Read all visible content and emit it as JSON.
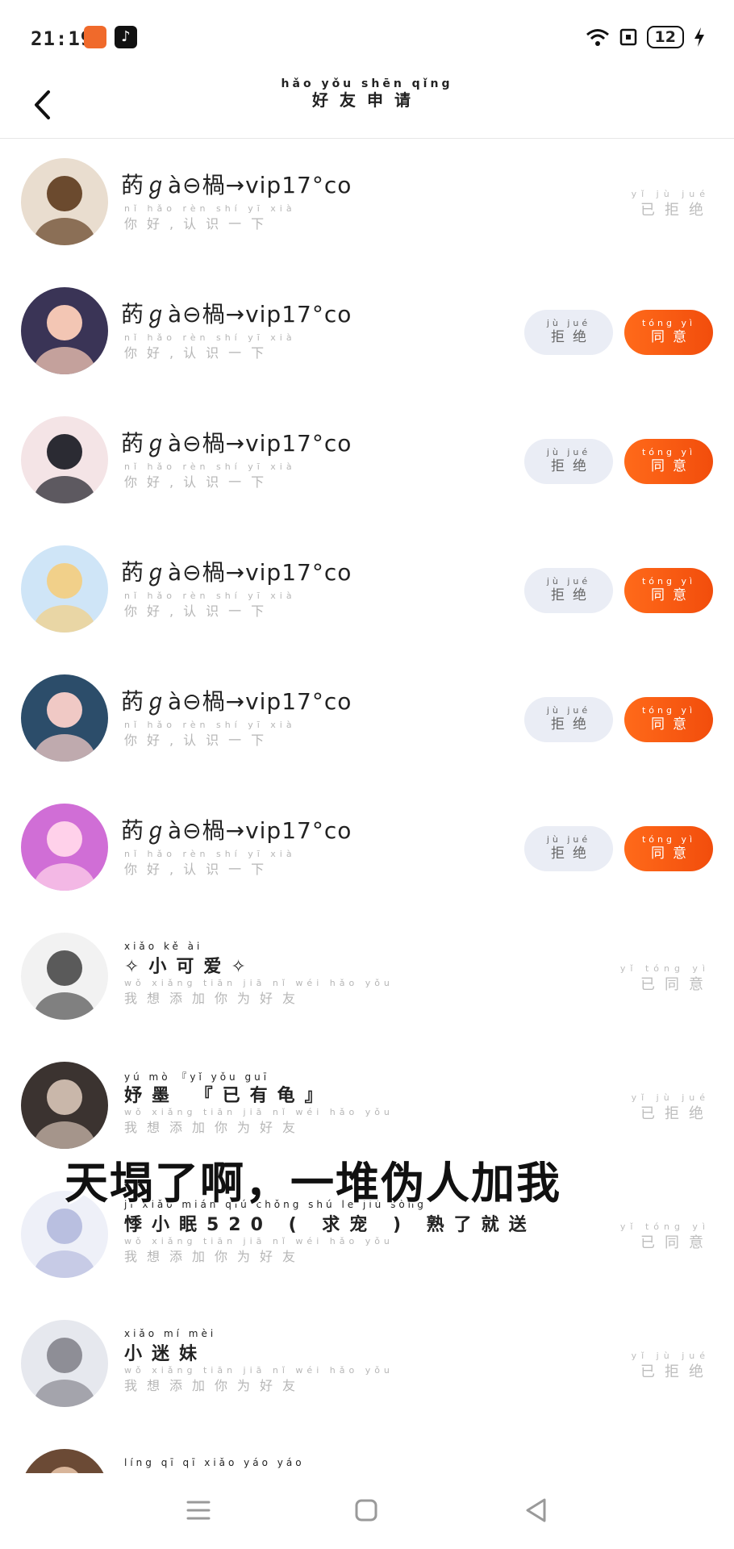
{
  "status_bar": {
    "time": "21:19",
    "battery": "12",
    "tiktok_glyph": "♪"
  },
  "header": {
    "title_pinyin": "hǎo yǒu shēn qǐng",
    "title": "好友申请"
  },
  "requests": [
    {
      "avatar": {
        "bg": "#e9ddcf",
        "fg": "#6b4a2e"
      },
      "name": "菂ℊà⊖楇→vip17°co",
      "msg_pinyin": "nǐ hǎo rèn shí yī xià",
      "msg": "你好,认识一下",
      "status_pinyin": "yǐ jù jué",
      "status": "已拒绝",
      "actions": false
    },
    {
      "avatar": {
        "bg": "#3a3456",
        "fg": "#f3c6b4"
      },
      "name": "菂ℊà⊖楇→vip17°co",
      "msg_pinyin": "nǐ hǎo rèn shí yī xià",
      "msg": "你好,认识一下",
      "actions": true
    },
    {
      "avatar": {
        "bg": "#f4e4e6",
        "fg": "#2b2b33"
      },
      "name": "菂ℊà⊖楇→vip17°co",
      "msg_pinyin": "nǐ hǎo rèn shí yī xià",
      "msg": "你好,认识一下",
      "actions": true
    },
    {
      "avatar": {
        "bg": "#cfe5f7",
        "fg": "#f1d08a"
      },
      "name": "菂ℊà⊖楇→vip17°co",
      "msg_pinyin": "nǐ hǎo rèn shí yī xià",
      "msg": "你好,认识一下",
      "actions": true
    },
    {
      "avatar": {
        "bg": "#2c4d6a",
        "fg": "#f0c9c5"
      },
      "name": "菂ℊà⊖楇→vip17°co",
      "msg_pinyin": "nǐ hǎo rèn shí yī xià",
      "msg": "你好,认识一下",
      "actions": true
    },
    {
      "avatar": {
        "bg": "#d06ed6",
        "fg": "#ffd1ea"
      },
      "name": "菂ℊà⊖楇→vip17°co",
      "msg_pinyin": "nǐ hǎo rèn shí yī xià",
      "msg": "你好,认识一下",
      "actions": true
    },
    {
      "avatar": {
        "bg": "#f2f2f2",
        "fg": "#5a5a5a"
      },
      "name_pinyin": "xiǎo kě ài",
      "name": "✧小可爱✧",
      "msg_pinyin": "wǒ xiǎng tiān jiā nǐ wéi hǎo yǒu",
      "msg": "我想添加你为好友",
      "status_pinyin": "yǐ tóng yì",
      "status": "已同意",
      "actions": false
    },
    {
      "avatar": {
        "bg": "#3b3330",
        "fg": "#c9b7aa"
      },
      "name_pinyin": "yú mò 『yǐ yǒu guī",
      "name": "妤墨 『已有龟』",
      "msg_pinyin": "wǒ xiǎng tiān jiā nǐ wéi hǎo yǒu",
      "msg": "我想添加你为好友",
      "status_pinyin": "yǐ jù jué",
      "status": "已拒绝",
      "actions": false
    },
    {
      "avatar": {
        "bg": "#eef0f8",
        "fg": "#b9bfe0"
      },
      "name_pinyin": "jì xiǎo mián qiú chǒng shú le jiù sòng",
      "name": "悸小眠520 ( 求宠 ) 熟了就送",
      "msg_pinyin": "wǒ xiǎng tiān jiā nǐ wéi hǎo yǒu",
      "msg": "我想添加你为好友",
      "status_pinyin": "yǐ tóng yì",
      "status": "已同意",
      "actions": false
    },
    {
      "avatar": {
        "bg": "#e6e8ee",
        "fg": "#8e8e96"
      },
      "name_pinyin": "xiǎo mí mèi",
      "name": "小迷妹",
      "msg_pinyin": "wǒ xiǎng tiān jiā nǐ wéi hǎo yǒu",
      "msg": "我想添加你为好友",
      "status_pinyin": "yǐ jù jué",
      "status": "已拒绝",
      "actions": false
    },
    {
      "avatar": {
        "bg": "#6b4a35",
        "fg": "#d8b59a"
      },
      "name_pinyin": "líng qī qī xiǎo yáo yáo",
      "name": "",
      "msg_pinyin": "",
      "msg": "",
      "actions": false
    }
  ],
  "buttons": {
    "reject_pinyin": "jù jué",
    "reject": "拒绝",
    "accept_pinyin": "tóng yì",
    "accept": "同意"
  },
  "caption": "天塌了啊，一堆伪人加我",
  "colors": {
    "accent": "#f45a14",
    "reject_bg": "#eaedf5",
    "muted_text": "#b6b6b6"
  },
  "icons": {
    "back": "chevron-left-icon",
    "wifi": "wifi-icon",
    "sim": "sim-icon",
    "charging": "lightning-icon",
    "nav_menu": "menu-icon",
    "nav_home": "home-square-icon",
    "nav_back": "triangle-back-icon"
  }
}
